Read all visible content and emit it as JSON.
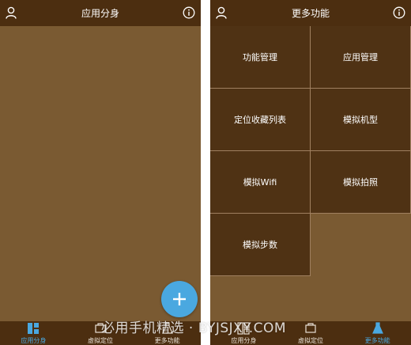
{
  "left": {
    "header": {
      "title": "应用分身",
      "user_icon": "user-icon",
      "info_icon": "info-icon"
    },
    "fab": {
      "icon": "plus-icon"
    },
    "tabbar": [
      {
        "label": "应用分身",
        "icon": "apps-grid-icon",
        "active": true
      },
      {
        "label": "虚拟定位",
        "icon": "location-icon",
        "active": false
      },
      {
        "label": "更多功能",
        "icon": "flask-icon",
        "active": false
      }
    ]
  },
  "right": {
    "header": {
      "title": "更多功能",
      "user_icon": "user-icon",
      "info_icon": "info-icon"
    },
    "grid": [
      "功能管理",
      "应用管理",
      "定位收藏列表",
      "模拟机型",
      "模拟Wifi",
      "模拟拍照",
      "模拟步数"
    ],
    "tabbar": [
      {
        "label": "应用分身",
        "icon": "apps-grid-icon",
        "active": false
      },
      {
        "label": "虚拟定位",
        "icon": "location-icon",
        "active": false
      },
      {
        "label": "更多功能",
        "icon": "flask-icon",
        "active": true
      }
    ]
  },
  "watermark": "必用手机精选 · BYJSJXY.COM",
  "colors": {
    "background": "#7a5a32",
    "header": "#4c2e10",
    "cell": "#4f3214",
    "accent": "#4aa8e0"
  }
}
